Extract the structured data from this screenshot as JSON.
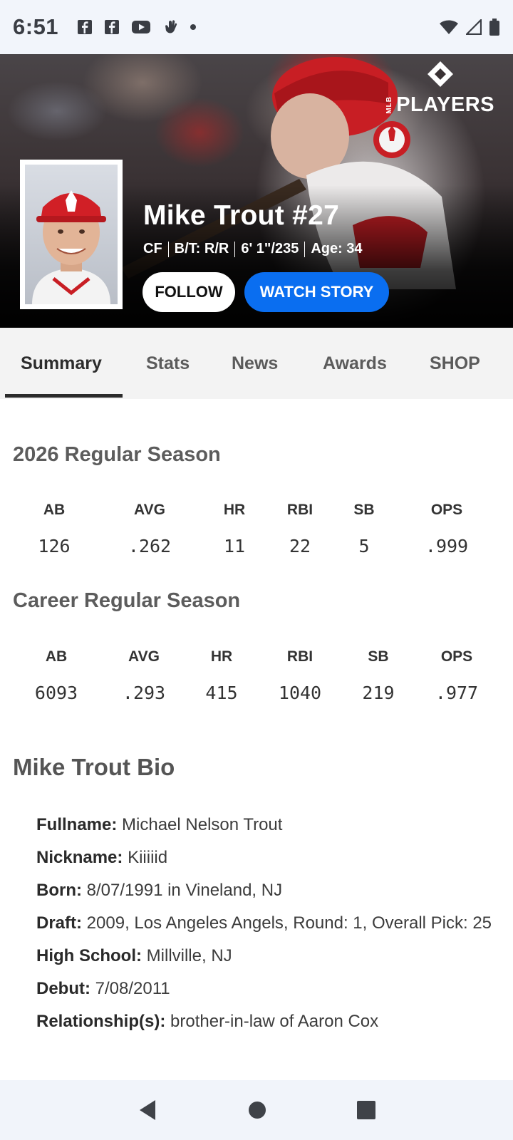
{
  "status_bar": {
    "time": "6:51",
    "notification_icons": [
      "facebook-icon",
      "facebook-icon",
      "youtube-icon",
      "hand-icon",
      "dot-icon"
    ],
    "system_icons": [
      "wifi-icon",
      "signal-icon",
      "battery-icon"
    ]
  },
  "hero": {
    "brand_logo": "PLAYERS",
    "brand_sub": "MLB",
    "player_name": "Mike Trout #27",
    "meta": {
      "position": "CF",
      "bats_throws": "B/T: R/R",
      "height_weight": "6' 1\"/235",
      "age": "Age: 34"
    },
    "follow_label": "FOLLOW",
    "watch_label": "WATCH STORY"
  },
  "tabs": [
    {
      "label": "Summary",
      "active": true
    },
    {
      "label": "Stats",
      "active": false
    },
    {
      "label": "News",
      "active": false
    },
    {
      "label": "Awards",
      "active": false
    },
    {
      "label": "SHOP",
      "active": false
    }
  ],
  "season": {
    "title": "2026 Regular Season",
    "stats": [
      {
        "label": "AB",
        "value": "126"
      },
      {
        "label": "AVG",
        "value": ".262"
      },
      {
        "label": "HR",
        "value": "11"
      },
      {
        "label": "RBI",
        "value": "22"
      },
      {
        "label": "SB",
        "value": "5"
      },
      {
        "label": "OPS",
        "value": ".999"
      }
    ]
  },
  "career": {
    "title": "Career Regular Season",
    "stats": [
      {
        "label": "AB",
        "value": "6093"
      },
      {
        "label": "AVG",
        "value": ".293"
      },
      {
        "label": "HR",
        "value": "415"
      },
      {
        "label": "RBI",
        "value": "1040"
      },
      {
        "label": "SB",
        "value": "219"
      },
      {
        "label": "OPS",
        "value": ".977"
      }
    ]
  },
  "bio": {
    "title": "Mike Trout Bio",
    "rows": [
      {
        "label": "Fullname:",
        "value": "Michael Nelson Trout"
      },
      {
        "label": "Nickname:",
        "value": "Kiiiiid"
      },
      {
        "label": "Born:",
        "value": "8/07/1991 in Vineland, NJ"
      },
      {
        "label": "Draft:",
        "value": "2009, Los Angeles Angels, Round: 1, Overall Pick: 25"
      },
      {
        "label": "High School:",
        "value": "Millville, NJ"
      },
      {
        "label": "Debut:",
        "value": "7/08/2011"
      },
      {
        "label": "Relationship(s):",
        "value": "brother-in-law of Aaron Cox"
      }
    ]
  },
  "nav": [
    "back-icon",
    "home-icon",
    "recents-icon"
  ],
  "colors": {
    "accent_blue": "#0a6ef0",
    "angels_red": "#c81e24"
  }
}
